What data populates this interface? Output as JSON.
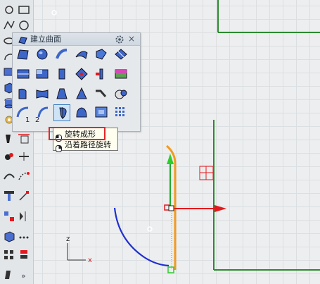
{
  "panel": {
    "title": "建立曲面",
    "close_label": "×"
  },
  "panel_labels": {
    "num1": "1",
    "num2": "2"
  },
  "tooltip": {
    "item1": "旋转成形",
    "item2": "沿着路径旋转"
  },
  "axis": {
    "z_label": "z",
    "x_label": "x"
  },
  "left_toolbar": {
    "more_label": "»"
  },
  "colors": {
    "highlight_box": "#e8262a",
    "curve_orange": "#f39a1e",
    "curve_blue": "#1f2fd0",
    "axis_green": "#1faa2e",
    "axis_red": "#e3191d",
    "viewport_green_line": "#2b8a2e"
  }
}
